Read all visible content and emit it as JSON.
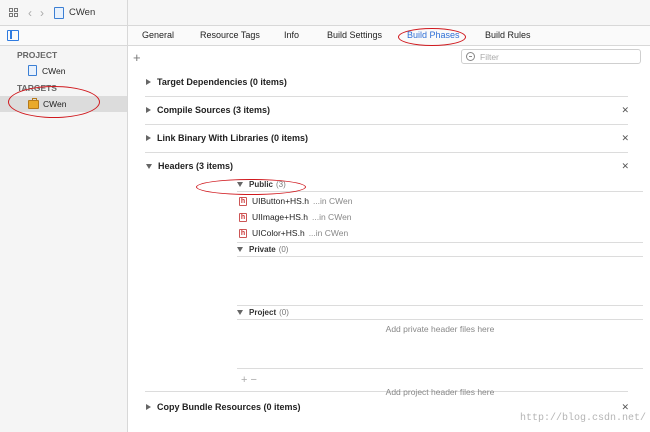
{
  "jumpbar": {
    "title": "CWen"
  },
  "tabs": [
    {
      "label": "General"
    },
    {
      "label": "Resource Tags"
    },
    {
      "label": "Info"
    },
    {
      "label": "Build Settings"
    },
    {
      "label": "Build Phases"
    },
    {
      "label": "Build Rules"
    }
  ],
  "active_tab": "Build Phases",
  "sidebar": {
    "project_header": "PROJECT",
    "project_item": "CWen",
    "targets_header": "TARGETS",
    "target_item": "CWen"
  },
  "toolbar": {
    "add": "+",
    "filter_placeholder": "Filter"
  },
  "phases": [
    {
      "title": "Target Dependencies (0 items)"
    },
    {
      "title": "Compile Sources (3 items)"
    },
    {
      "title": "Link Binary With Libraries (0 items)"
    },
    {
      "title": "Headers (3 items)"
    },
    {
      "title": "Copy Bundle Resources (0 items)"
    }
  ],
  "headers": {
    "public": {
      "label": "Public",
      "count": "(3)"
    },
    "files": [
      {
        "name": "UIButton+HS.h",
        "location": "...in CWen"
      },
      {
        "name": "UIImage+HS.h",
        "location": "...in CWen"
      },
      {
        "name": "UIColor+HS.h",
        "location": "...in CWen"
      }
    ],
    "private": {
      "label": "Private",
      "count": "(0)",
      "placeholder": "Add private header files here"
    },
    "project": {
      "label": "Project",
      "count": "(0)",
      "placeholder": "Add project header files here"
    },
    "add_remove": "+ −"
  },
  "watermark": "http://blog.csdn.net/",
  "colors": {
    "accent": "#2f6fd6",
    "annotation": "#d0191e"
  }
}
